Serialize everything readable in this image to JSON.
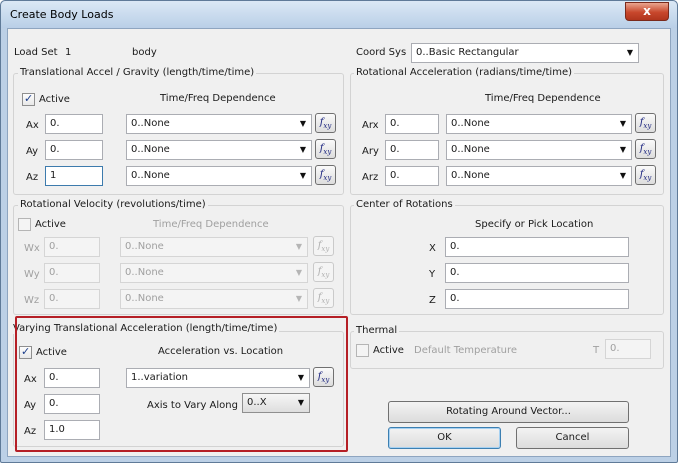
{
  "window": {
    "title": "Create Body Loads",
    "close_glyph": "x"
  },
  "header": {
    "load_set_label": "Load Set",
    "load_set_id": "1",
    "load_set_name": "body",
    "coord_sys_label": "Coord Sys",
    "coord_sys_value": "0..Basic Rectangular"
  },
  "translational": {
    "title": "Translational Accel / Gravity  (length/time/time)",
    "active_label": "Active",
    "active_checked": true,
    "dependence_header": "Time/Freq Dependence",
    "rows": [
      {
        "label": "Ax",
        "value": "0.",
        "dep": "0..None"
      },
      {
        "label": "Ay",
        "value": "0.",
        "dep": "0..None"
      },
      {
        "label": "Az",
        "value": "1",
        "dep": "0..None"
      }
    ]
  },
  "rotational_accel": {
    "title": "Rotational Acceleration (radians/time/time)",
    "dependence_header": "Time/Freq Dependence",
    "rows": [
      {
        "label": "Arx",
        "value": "0.",
        "dep": "0..None"
      },
      {
        "label": "Ary",
        "value": "0.",
        "dep": "0..None"
      },
      {
        "label": "Arz",
        "value": "0.",
        "dep": "0..None"
      }
    ]
  },
  "rotational_velocity": {
    "title": "Rotational Velocity (revolutions/time)",
    "active_label": "Active",
    "active_checked": false,
    "dependence_header": "Time/Freq Dependence",
    "rows": [
      {
        "label": "Wx",
        "value": "0.",
        "dep": "0..None"
      },
      {
        "label": "Wy",
        "value": "0.",
        "dep": "0..None"
      },
      {
        "label": "Wz",
        "value": "0.",
        "dep": "0..None"
      }
    ]
  },
  "center": {
    "title": "Center of Rotations",
    "hint": "Specify or Pick Location",
    "rows": [
      {
        "label": "X",
        "value": "0."
      },
      {
        "label": "Y",
        "value": "0."
      },
      {
        "label": "Z",
        "value": "0."
      }
    ]
  },
  "varying": {
    "title": "Varying Translational Acceleration   (length/time/time)",
    "active_label": "Active",
    "active_checked": true,
    "vs_header": "Acceleration vs. Location",
    "rows": [
      {
        "label": "Ax",
        "value": "0."
      },
      {
        "label": "Ay",
        "value": "0."
      },
      {
        "label": "Az",
        "value": "1.0"
      }
    ],
    "function_value": "1..variation",
    "axis_label": "Axis to Vary Along",
    "axis_value": "0..X"
  },
  "thermal": {
    "title": "Thermal",
    "active_label": "Active",
    "active_checked": false,
    "default_temp_label": "Default Temperature",
    "t_label": "T",
    "t_value": "0."
  },
  "buttons": {
    "rotating": "Rotating Around Vector...",
    "ok": "OK",
    "cancel": "Cancel"
  },
  "icons": {
    "fxy": "function-xy-icon",
    "dropdown": "chevron-down-icon",
    "check": "checkmark-icon"
  },
  "colors": {
    "highlight_box": "#b51f26",
    "title_gradient": "#c9dcef",
    "close_button": "#c8472c"
  }
}
